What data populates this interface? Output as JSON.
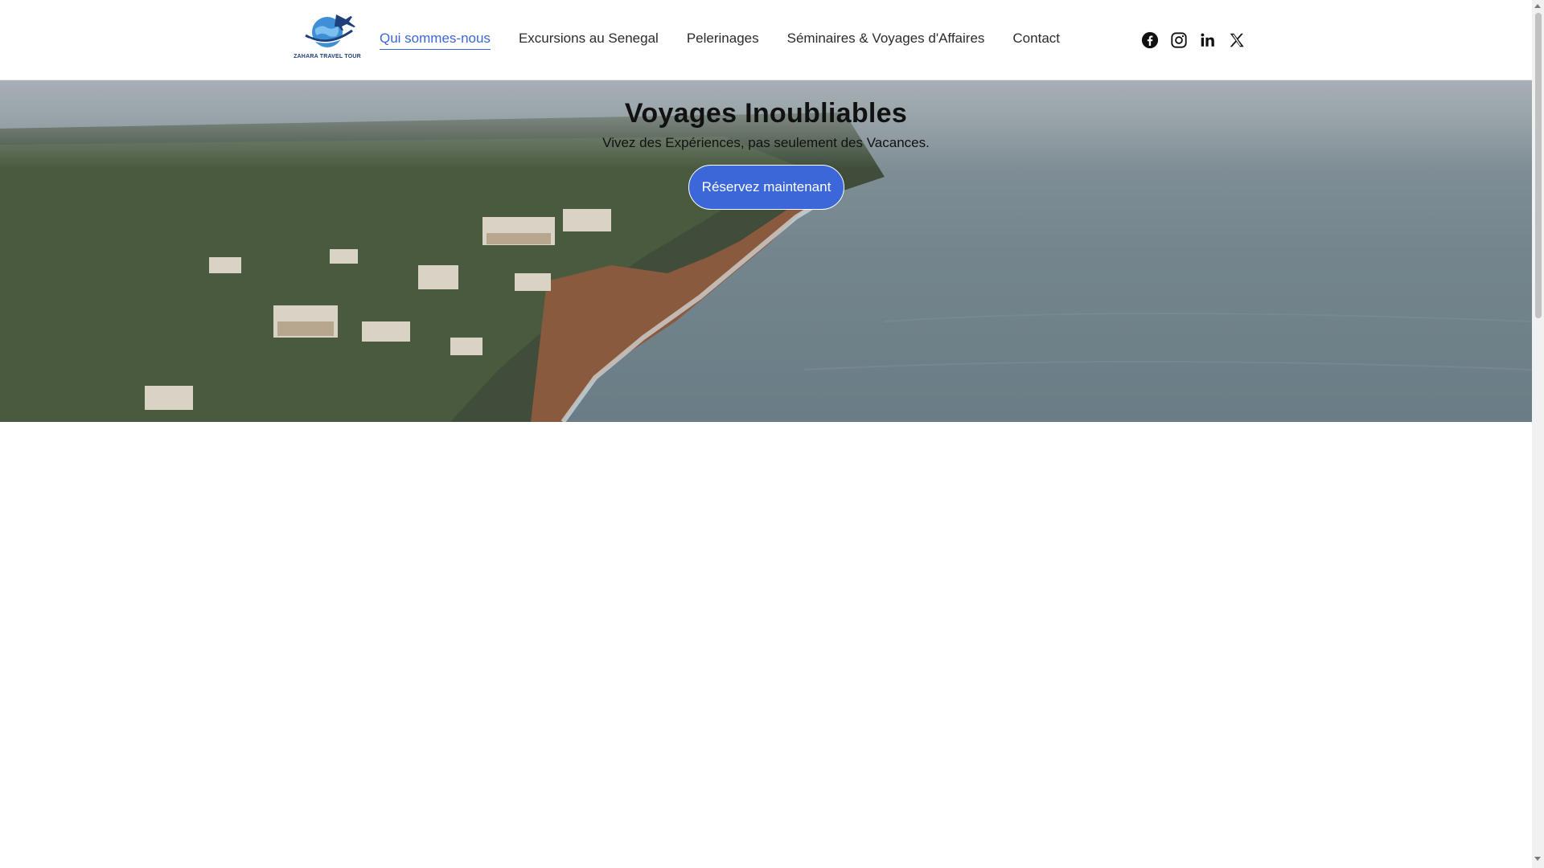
{
  "brand": {
    "name": "ZAHARA TRAVEL TOUR",
    "logo_icon": "globe-airplane-logo",
    "accent_color": "#3b67d8"
  },
  "nav": {
    "items": [
      {
        "label": "Qui sommes-nous",
        "active": true
      },
      {
        "label": "Excursions au Senegal",
        "active": false
      },
      {
        "label": "Pelerinages",
        "active": false
      },
      {
        "label": "Séminaires & Voyages d'Affaires",
        "active": false
      },
      {
        "label": "Contact",
        "active": false
      }
    ]
  },
  "socials": [
    {
      "icon": "facebook-icon"
    },
    {
      "icon": "instagram-icon"
    },
    {
      "icon": "linkedin-icon"
    },
    {
      "icon": "x-twitter-icon"
    }
  ],
  "hero": {
    "title": "Voyages Inoubliables",
    "subtitle": "Vivez des Expériences, pas seulement des Vacances.",
    "cta_label": "Réservez maintenant",
    "background": "aerial coastline photo"
  }
}
